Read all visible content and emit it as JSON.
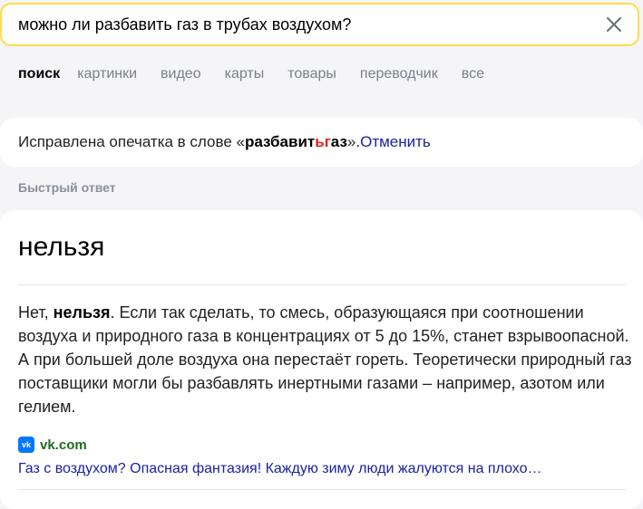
{
  "search": {
    "query": "можно ли разбавить газ в трубах воздухом?"
  },
  "tabs": [
    {
      "label": "поиск",
      "active": true
    },
    {
      "label": "картинки",
      "active": false
    },
    {
      "label": "видео",
      "active": false
    },
    {
      "label": "карты",
      "active": false
    },
    {
      "label": "товары",
      "active": false
    },
    {
      "label": "переводчик",
      "active": false
    },
    {
      "label": "все",
      "active": false
    }
  ],
  "correction": {
    "prefix": "Исправлена опечатка в слове «",
    "word_start": "разбавит",
    "word_highlight": "ьг",
    "word_end": "аз",
    "suffix": "». ",
    "cancel_label": "Отменить"
  },
  "quick_answer": {
    "section_label": "Быстрый ответ",
    "title": "нельзя",
    "text_lead": "Нет, ",
    "text_bold": "нельзя",
    "text_rest": ". Если так сделать, то смесь, образующаяся при соотношении воздуха и природного газа в концентрациях от 5 до 15%, станет взрывоопасной. А при большей доле воздуха она перестаёт гореть. Теоретически природный газ поставщики могли бы разбавлять инертными газами – например, азотом или гелием.",
    "source_icon_label": "vk",
    "source_domain": "vk.com",
    "source_title": "Газ с воздухом? Опасная фантазия! Каждую зиму люди жалуются на плохо…"
  },
  "colors": {
    "search_border": "#ffdb4d",
    "link": "#1a23a0",
    "source_domain": "#1e6d1e",
    "typo_highlight": "#e0231b",
    "vk_brand": "#0077ff"
  }
}
